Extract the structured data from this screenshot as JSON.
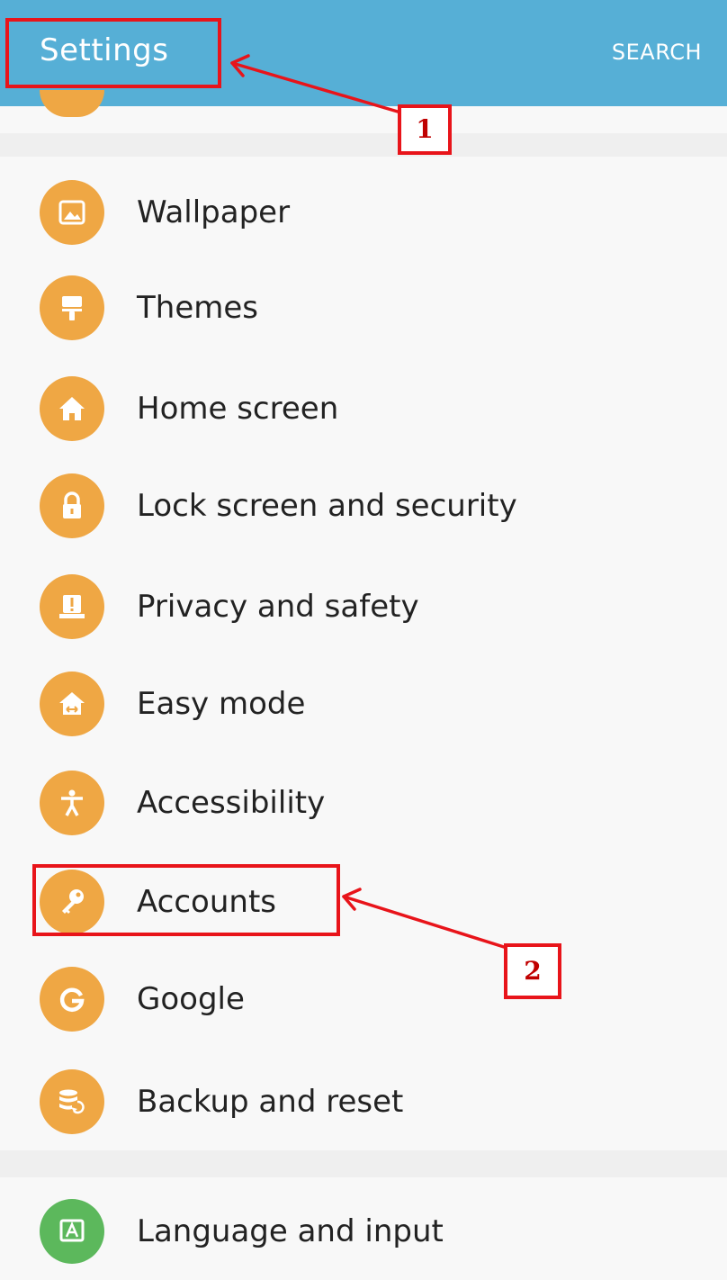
{
  "app_bar": {
    "title": "Settings",
    "search_label": "SEARCH"
  },
  "items": [
    {
      "label": "Wallpaper",
      "icon": "wallpaper-icon"
    },
    {
      "label": "Themes",
      "icon": "paint-brush-icon"
    },
    {
      "label": "Home screen",
      "icon": "home-icon"
    },
    {
      "label": "Lock screen and security",
      "icon": "lock-icon"
    },
    {
      "label": "Privacy and safety",
      "icon": "alert-icon"
    },
    {
      "label": "Easy mode",
      "icon": "easy-mode-icon"
    },
    {
      "label": "Accessibility",
      "icon": "accessibility-icon"
    },
    {
      "label": "Accounts",
      "icon": "key-icon"
    },
    {
      "label": "Google",
      "icon": "google-icon"
    },
    {
      "label": "Backup and reset",
      "icon": "backup-icon"
    },
    {
      "label": "Language and input",
      "icon": "language-icon"
    }
  ],
  "annotations": {
    "marker_1": "1",
    "marker_2": "2"
  },
  "colors": {
    "app_bar": "#56afd6",
    "icon_orange": "#efa744",
    "icon_green": "#5cb85c",
    "annotation_red": "#e8141a"
  }
}
